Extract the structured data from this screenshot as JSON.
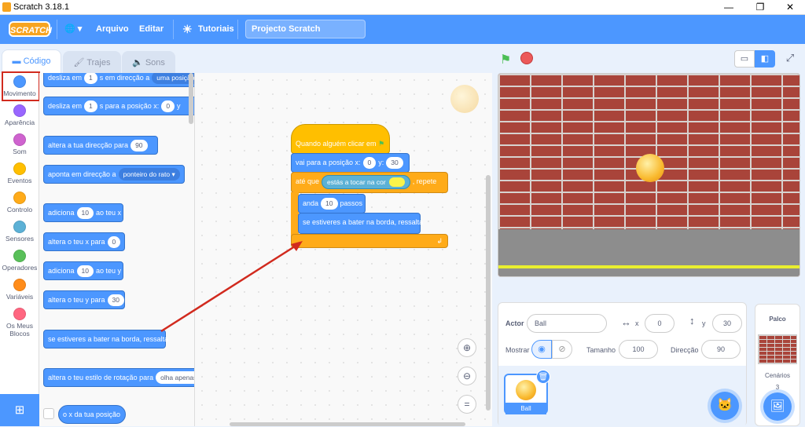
{
  "window": {
    "title": "Scratch 3.18.1",
    "min": "—",
    "max": "❐",
    "close": "✕"
  },
  "menu": {
    "logo": "SCRATCH",
    "globe": "🌐 ▾",
    "file": "Arquivo",
    "edit": "Editar",
    "tutorials": "Tutoriais",
    "project_title": "Projecto Scratch"
  },
  "tabs": {
    "code": "Código",
    "costumes": "Trajes",
    "sounds": "Sons"
  },
  "categories": [
    {
      "label": "Movimento",
      "color": "#4c97ff"
    },
    {
      "label": "Aparência",
      "color": "#9966ff"
    },
    {
      "label": "Som",
      "color": "#cf63cf"
    },
    {
      "label": "Eventos",
      "color": "#ffbf00"
    },
    {
      "label": "Controlo",
      "color": "#ffab19"
    },
    {
      "label": "Sensores",
      "color": "#5cb1d6"
    },
    {
      "label": "Operadores",
      "color": "#59c059"
    },
    {
      "label": "Variáveis",
      "color": "#ff8c1a"
    },
    {
      "label": "Os Meus Blocos",
      "color": "#ff6680"
    }
  ],
  "palette": {
    "glide1": {
      "a": "desliza em",
      "n": "1",
      "b": "s em direcção a",
      "dd": "uma posição"
    },
    "glide2": {
      "a": "desliza em",
      "n": "1",
      "b": "s para a posição x:",
      "x": "0",
      "c": "y"
    },
    "point_dir": {
      "a": "altera a tua direcção para",
      "n": "90"
    },
    "point_towards": {
      "a": "aponta em direcção a",
      "dd": "ponteiro do rato ▾"
    },
    "change_x": {
      "a": "adiciona",
      "n": "10",
      "b": "ao teu x"
    },
    "set_x": {
      "a": "altera o teu x para",
      "n": "0"
    },
    "change_y": {
      "a": "adiciona",
      "n": "10",
      "b": "ao teu y"
    },
    "set_y": {
      "a": "altera o teu y para",
      "n": "30"
    },
    "bounce": "se estiveres a bater na borda, ressalta",
    "rotation": {
      "a": "altera o teu estilo de rotação para",
      "dd": "olha apenas"
    },
    "x_pos": "o x da tua posição"
  },
  "script": {
    "hat": "Quando alguém clicar em",
    "goto": {
      "a": "vai para a posição x:",
      "x": "0",
      "b": "y:",
      "y": "30"
    },
    "until": {
      "a": "até que",
      "sense": "estás a tocar na cor",
      "b": ", repete"
    },
    "move": {
      "a": "anda",
      "n": "10",
      "b": "passos"
    },
    "bounce": "se estiveres a bater na borda, ressalta"
  },
  "sprite": {
    "actor_label": "Actor",
    "actor_name": "Ball",
    "x_label": "x",
    "x": "0",
    "y_label": "y",
    "y": "30",
    "show_label": "Mostrar",
    "size_label": "Tamanho",
    "size": "100",
    "dir_label": "Direcção",
    "dir": "90",
    "thumb_label": "Ball"
  },
  "stage_panel": {
    "title": "Palco",
    "backdrops_label": "Cenários",
    "backdrops_count": "3"
  }
}
